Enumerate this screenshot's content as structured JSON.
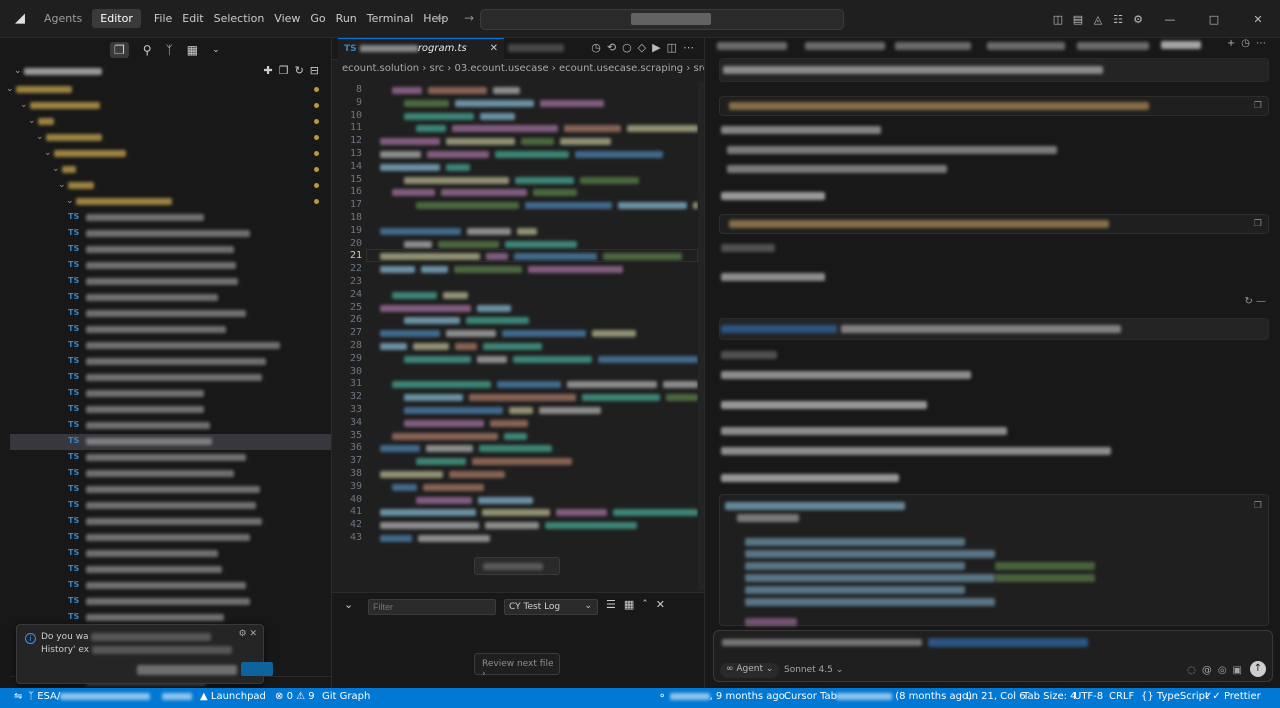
{
  "titlebar": {
    "tabs": [
      {
        "label": "Agents",
        "active": false
      },
      {
        "label": "Editor",
        "active": true
      }
    ],
    "menu": [
      "File",
      "Edit",
      "Selection",
      "View",
      "Go",
      "Run",
      "Terminal",
      "Help"
    ]
  },
  "editor": {
    "breadcrumb": [
      "ecount.solution",
      "src",
      "03.ecount.usecase",
      "ecount.usecase.scraping",
      "src",
      "server"
    ],
    "active_tab_suffix": "rogram.ts",
    "active_tab_icon": "TS",
    "line_numbers": [
      8,
      9,
      10,
      11,
      12,
      13,
      14,
      15,
      16,
      17,
      18,
      19,
      20,
      21,
      22,
      23,
      24,
      25,
      26,
      27,
      28,
      29,
      30,
      31,
      32,
      33,
      34,
      35,
      36,
      37,
      38,
      39,
      40,
      41,
      42,
      43
    ],
    "current_line": 21,
    "review_label": "Review next file"
  },
  "panel": {
    "filter_placeholder": "Filter",
    "channel": "CY Test Log"
  },
  "notification": {
    "message_start": "Do you wa",
    "message_line2": "History' ex"
  },
  "explorer": {
    "file_icon": "TS"
  },
  "chat": {
    "agent_label": "Agent",
    "model_label": "Sonnet 4.5"
  },
  "statusbar": {
    "branch_prefix": "ESA/",
    "launchpad": "Launchpad",
    "problems": "0",
    "warnings": "9",
    "git_graph": "Git Graph",
    "blame_time": "9 months ago",
    "cursor_tab": "Cursor Tab",
    "blame_ago": "(8 months ago)",
    "position": "Ln 21, Col 6",
    "tab_size": "Tab Size: 4",
    "encoding": "UTF-8",
    "eol": "CRLF",
    "language": "TypeScript",
    "formatter": "Prettier"
  }
}
